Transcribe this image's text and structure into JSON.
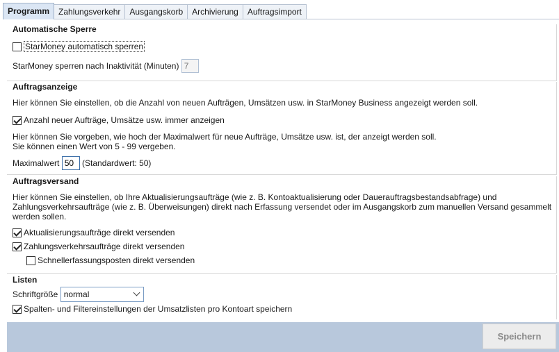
{
  "tabs": [
    {
      "label": "Programm"
    },
    {
      "label": "Zahlungsverkehr"
    },
    {
      "label": "Ausgangskorb"
    },
    {
      "label": "Archivierung"
    },
    {
      "label": "Auftragsimport"
    }
  ],
  "sperre": {
    "title": "Automatische Sperre",
    "auto_lock_label": "StarMoney automatisch sperren",
    "auto_lock_checked": false,
    "inactivity_label": "StarMoney sperren nach Inaktivität (Minuten)",
    "inactivity_value": "7"
  },
  "anzeige": {
    "title": "Auftragsanzeige",
    "description": "Hier können Sie einstellen, ob die Anzahl von neuen Aufträgen, Umsätzen usw. in StarMoney Business angezeigt werden soll.",
    "show_count_label": "Anzahl neuer Aufträge, Umsätze usw. immer anzeigen",
    "show_count_checked": true,
    "max_desc_1": "Hier können Sie vorgeben, wie hoch der Maximalwert für neue Aufträge, Umsätze usw. ist, der anzeigt werden soll.",
    "max_desc_2": "Sie können einen Wert von 5 - 99 vergeben.",
    "max_label": "Maximalwert",
    "max_value": "50",
    "max_default": "(Standardwert: 50)"
  },
  "versand": {
    "title": "Auftragsversand",
    "desc_1": "Hier können Sie einstellen, ob Ihre Aktualisierungsaufträge (wie z. B. Kontoaktualisierung oder Dauerauftragsbestandsabfrage) und",
    "desc_2": "Zahlungsverkehrsaufträge (wie z. B. Überweisungen) direkt nach Erfassung versendet oder im Ausgangskorb zum manuellen Versand gesammelt",
    "desc_3": "werden sollen.",
    "update_label": "Aktualisierungsaufträge direkt versenden",
    "update_checked": true,
    "payment_label": "Zahlungsverkehrsaufträge direkt versenden",
    "payment_checked": true,
    "quick_label": "Schnellerfassungsposten direkt versenden",
    "quick_checked": false
  },
  "listen": {
    "title": "Listen",
    "font_label": "Schriftgröße",
    "font_value": "normal",
    "columns_label": "Spalten- und Filtereinstellungen der Umsatzlisten pro Kontoart speichern",
    "columns_checked": true
  },
  "footer": {
    "save_label": "Speichern"
  }
}
